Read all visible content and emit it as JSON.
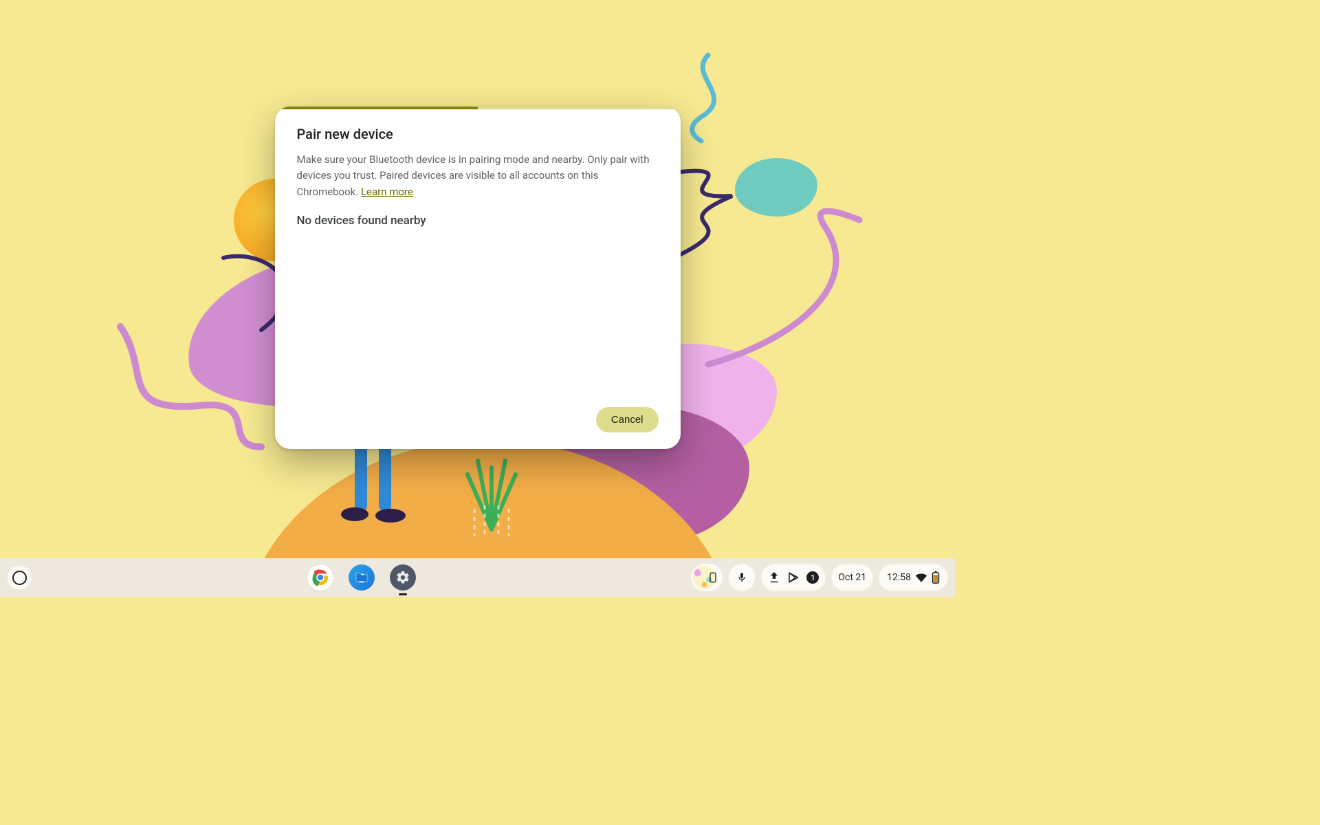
{
  "dialog": {
    "title": "Pair new device",
    "description_prefix": "Make sure your Bluetooth device is in pairing mode and nearby. Only pair with devices you trust. Paired devices are visible to all accounts on this Chromebook. ",
    "learn_more_label": "Learn more",
    "status_text": "No devices found nearby",
    "cancel_label": "Cancel"
  },
  "shelf": {
    "apps": {
      "chrome": "Google Chrome",
      "files": "Files",
      "settings": "Settings"
    },
    "notification_count": "1",
    "date_label": "Oct 21",
    "time_label": "12:58"
  }
}
